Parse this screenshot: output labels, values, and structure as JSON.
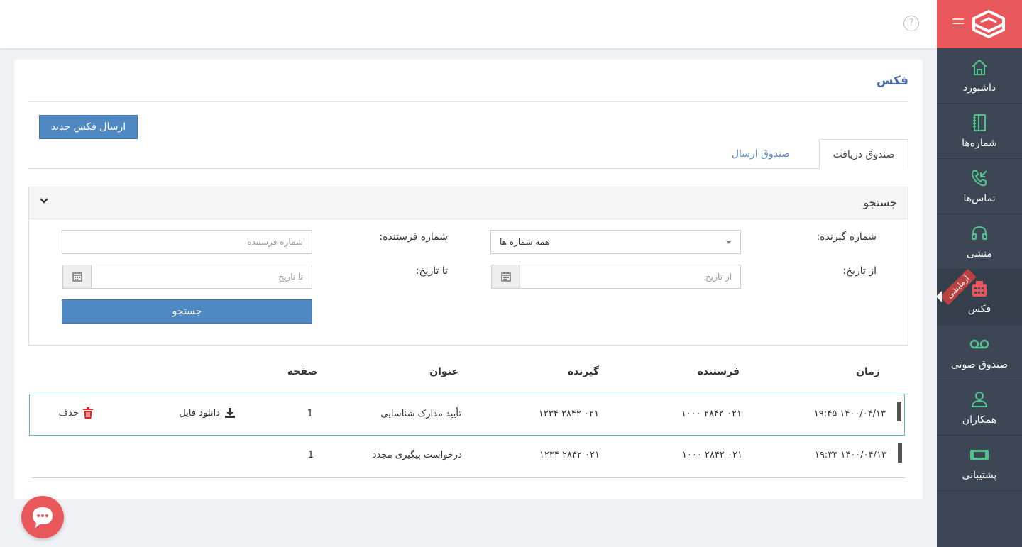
{
  "app": {
    "title": "فکس",
    "accent": "#e8575a",
    "sidebar_bg": "#3c4654",
    "primary": "#5088c4"
  },
  "sidebar": {
    "items": [
      {
        "label": "داشبورد",
        "icon": "home-icon"
      },
      {
        "label": "شماره‌ها",
        "icon": "notebook-icon"
      },
      {
        "label": "تماس‌ها",
        "icon": "incoming-call-icon"
      },
      {
        "label": "منشی",
        "icon": "headset-icon"
      },
      {
        "label": "فکس",
        "icon": "fax-icon",
        "active": true,
        "badge": "آزمایشی"
      },
      {
        "label": "صندوق صوتی",
        "icon": "voicemail-icon"
      },
      {
        "label": "همکاران",
        "icon": "users-icon"
      },
      {
        "label": "پشتیبانی",
        "icon": "ticket-icon"
      }
    ]
  },
  "page": {
    "title": "فکس",
    "new_fax_button": "ارسال فکس جدید",
    "tabs": [
      {
        "label": "صندوق دریافت",
        "active": true
      },
      {
        "label": "صندوق ارسال",
        "active": false
      }
    ]
  },
  "search": {
    "title": "جستجو",
    "receiver_label": "شماره گیرنده:",
    "receiver_value": "همه شماره ها",
    "sender_label": "شماره فرستنده:",
    "sender_placeholder": "شماره فرستنده",
    "from_date_label": "از تاریخ:",
    "from_date_placeholder": "از تاریخ",
    "to_date_label": "تا تاریخ:",
    "to_date_placeholder": "تا تاریخ",
    "submit": "جستجو"
  },
  "table": {
    "headers": [
      "زمان",
      "فرستنده",
      "گیرنده",
      "عنوان",
      "صفحه"
    ],
    "download_label": "دانلود فایل",
    "delete_label": "حذف",
    "rows": [
      {
        "time": "۱۴۰۰/۰۴/۱۳ ۱۹:۴۵",
        "sender": "۰۲۱ ۲۸۴۲ ۱۰۰۰",
        "receiver": "۰۲۱ ۲۸۴۲ ۱۲۳۴",
        "subject": "تأیید مدارک شناسایی",
        "pages": "1"
      },
      {
        "time": "۱۴۰۰/۰۴/۱۳ ۱۹:۳۳",
        "sender": "۰۲۱ ۲۸۴۲ ۱۰۰۰",
        "receiver": "۰۲۱ ۲۸۴۲ ۱۲۳۴",
        "subject": "درخواست پیگیری مجدد",
        "pages": "1"
      }
    ]
  }
}
